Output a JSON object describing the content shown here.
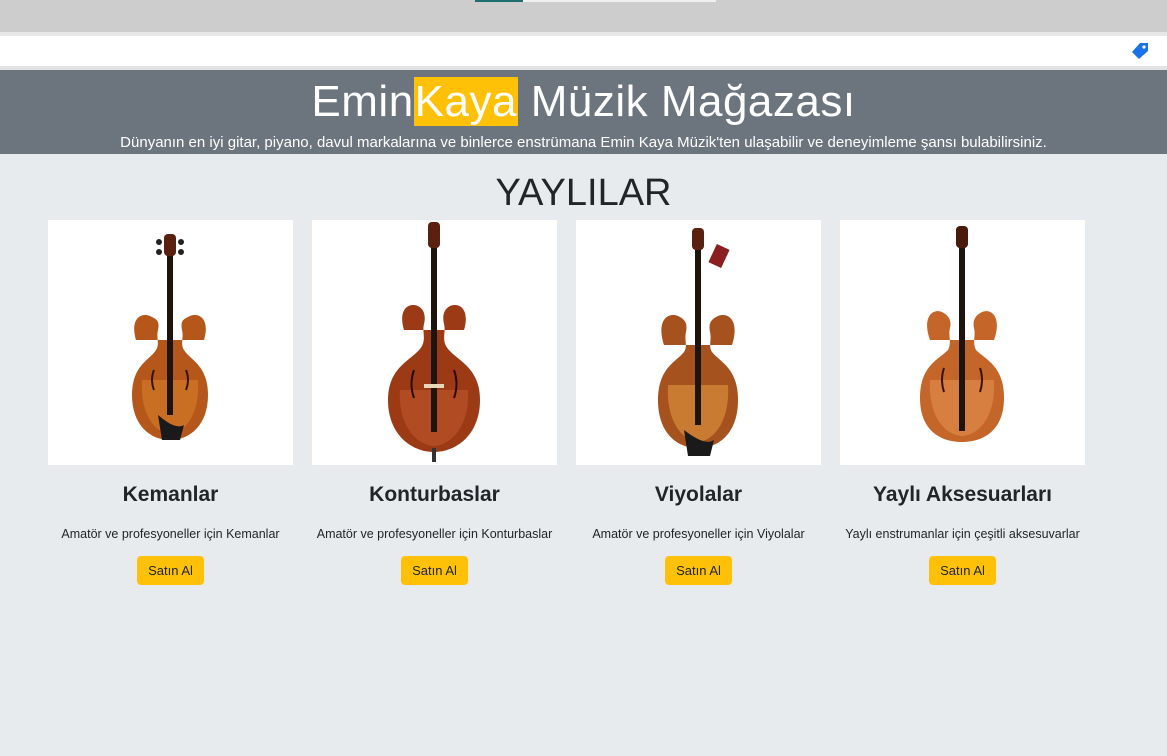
{
  "header": {
    "title_part1": "Emin",
    "title_highlight": "Kaya",
    "title_part2": " Müzik Mağazası",
    "subtitle": "Dünyanın en iyi gitar, piyano, davul markalarına ve binlerce enstrümana Emin Kaya Müzik'ten ulaşabilir ve deneyimleme şansı bulabilirsiniz."
  },
  "toolbar": {
    "icon": "tag-icon"
  },
  "section": {
    "title": "YAYLILAR"
  },
  "products": [
    {
      "title": "Kemanlar",
      "description": "Amatör ve profesyoneller için Kemanlar",
      "button": "Satın Al",
      "icon": "violin-image"
    },
    {
      "title": "Konturbaslar",
      "description": "Amatör ve profesyoneller için Konturbaslar",
      "button": "Satın Al",
      "icon": "double-bass-image"
    },
    {
      "title": "Viyolalar",
      "description": "Amatör ve profesyoneller için Viyolalar",
      "button": "Satın Al",
      "icon": "viola-image"
    },
    {
      "title": "Yaylı Aksesuarları",
      "description": "Yaylı enstrumanlar için çeşitli aksesuvarlar",
      "button": "Satın Al",
      "icon": "cello-image"
    }
  ],
  "colors": {
    "accent": "#ffc107",
    "hero_bg": "#6c757d",
    "page_bg": "#e8ebee"
  }
}
